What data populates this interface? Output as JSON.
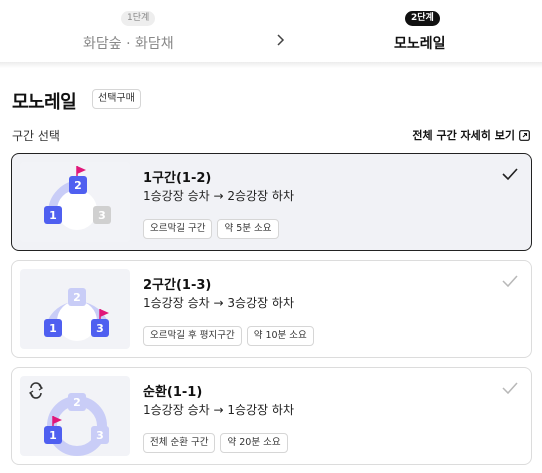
{
  "stepper": {
    "step1": {
      "badge": "1단계",
      "label": "화담숲 · 화담채"
    },
    "step2": {
      "badge": "2단계",
      "label": "모노레일"
    }
  },
  "header": {
    "title": "모노레일",
    "tag": "선택구매"
  },
  "section": {
    "label": "구간 선택",
    "detail_link": "전체 구간 자세히 보기"
  },
  "colors": {
    "accent_blue": "#4f5ff0",
    "track_light": "#c9cdf7",
    "flag_pink": "#e0177a",
    "inactive_stop": "#d0d0d0"
  },
  "routes": [
    {
      "name": "1구간(1-2)",
      "desc": "1승강장 승차 → 2승강장 하차",
      "tags": [
        "오르막길 구간",
        "약 5분 소요"
      ],
      "selected": true,
      "stops": [
        "1",
        "2",
        "3"
      ],
      "icon": "route-1-2-diagram"
    },
    {
      "name": "2구간(1-3)",
      "desc": "1승강장 승차 → 3승강장 하차",
      "tags": [
        "오르막길 후 평지구간",
        "약 10분 소요"
      ],
      "selected": false,
      "stops": [
        "1",
        "2",
        "3"
      ],
      "icon": "route-1-3-diagram"
    },
    {
      "name": "순환(1-1)",
      "desc": "1승강장 승차 → 1승강장 하차",
      "tags": [
        "전체 순환 구간",
        "약 20분 소요"
      ],
      "selected": false,
      "stops": [
        "1",
        "2",
        "3"
      ],
      "icon": "loop-route-diagram"
    }
  ]
}
